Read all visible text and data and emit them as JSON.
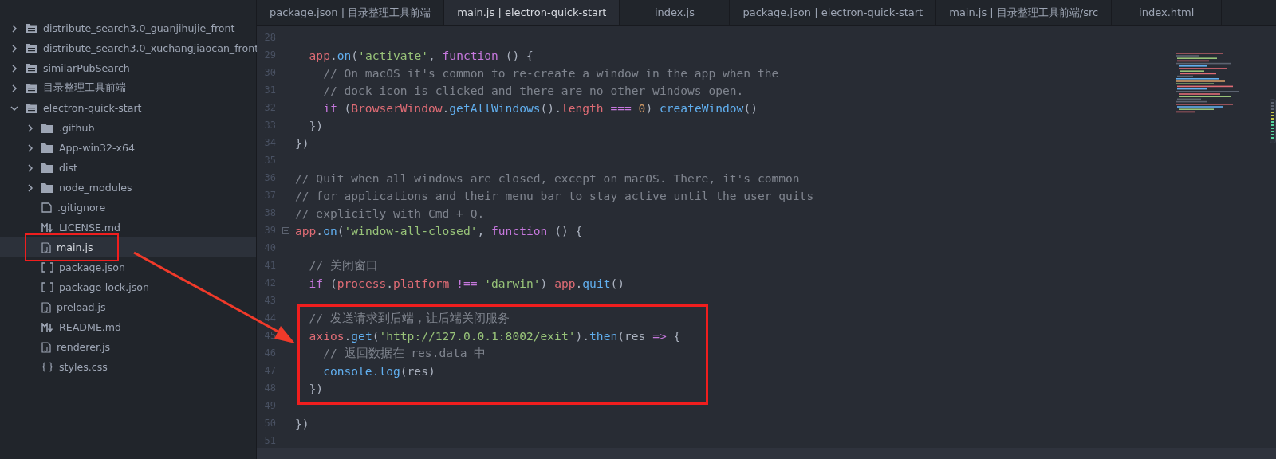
{
  "tree": [
    {
      "name": "distribute_search3.0_guanjihujie_front",
      "kind": "project",
      "expanded": false,
      "selected": false,
      "highlighted": false
    },
    {
      "name": "distribute_search3.0_xuchangjiaocan_front",
      "kind": "project",
      "expanded": false,
      "selected": false,
      "highlighted": false
    },
    {
      "name": "similarPubSearch",
      "kind": "project",
      "expanded": false,
      "selected": false,
      "highlighted": false
    },
    {
      "name": "目录整理工具前端",
      "kind": "project",
      "expanded": false,
      "selected": false,
      "highlighted": false
    },
    {
      "name": "electron-quick-start",
      "kind": "project",
      "expanded": true,
      "selected": false,
      "highlighted": false,
      "children": [
        {
          "name": ".github",
          "kind": "folder",
          "expanded": false,
          "selected": false,
          "highlighted": false
        },
        {
          "name": "App-win32-x64",
          "kind": "folder",
          "expanded": false,
          "selected": false,
          "highlighted": false
        },
        {
          "name": "dist",
          "kind": "folder",
          "expanded": false,
          "selected": false,
          "highlighted": false
        },
        {
          "name": "node_modules",
          "kind": "folder",
          "expanded": false,
          "selected": false,
          "highlighted": false
        },
        {
          "name": ".gitignore",
          "kind": "text",
          "selected": false,
          "highlighted": false
        },
        {
          "name": "LICENSE.md",
          "kind": "markdown",
          "selected": false,
          "highlighted": false
        },
        {
          "name": "main.js",
          "kind": "js",
          "selected": true,
          "highlighted": true
        },
        {
          "name": "package.json",
          "kind": "json",
          "selected": false,
          "highlighted": false
        },
        {
          "name": "package-lock.json",
          "kind": "json",
          "selected": false,
          "highlighted": false
        },
        {
          "name": "preload.js",
          "kind": "js",
          "selected": false,
          "highlighted": false
        },
        {
          "name": "README.md",
          "kind": "markdown",
          "selected": false,
          "highlighted": false
        },
        {
          "name": "renderer.js",
          "kind": "js",
          "selected": false,
          "highlighted": false
        },
        {
          "name": "styles.css",
          "kind": "css",
          "selected": false,
          "highlighted": false
        }
      ]
    }
  ],
  "tabs": [
    {
      "label": "package.json | 目录整理工具前端",
      "selected": false
    },
    {
      "label": "main.js | electron-quick-start",
      "selected": true
    },
    {
      "label": "index.js",
      "selected": false
    },
    {
      "label": "package.json | electron-quick-start",
      "selected": false
    },
    {
      "label": "main.js | 目录整理工具前端/src",
      "selected": false
    },
    {
      "label": "index.html",
      "selected": false
    }
  ],
  "code": [
    {
      "number": "28",
      "highlighted": false,
      "fold": false
    },
    {
      "number": "29",
      "highlighted": false,
      "fold": false,
      "tokens": [
        {
          "kind": "variable",
          "text": "  app"
        },
        {
          "kind": "plain",
          "text": "."
        },
        {
          "kind": "function",
          "text": "on"
        },
        {
          "kind": "plain",
          "text": "("
        },
        {
          "kind": "string",
          "text": "'activate'"
        },
        {
          "kind": "plain",
          "text": ", "
        },
        {
          "kind": "keyword",
          "text": "function"
        },
        {
          "kind": "plain",
          "text": " () {"
        }
      ]
    },
    {
      "number": "30",
      "highlighted": false,
      "fold": false,
      "tokens": [
        {
          "kind": "comment",
          "text": "    // On macOS it's common to re-create a window in the app when the"
        }
      ]
    },
    {
      "number": "31",
      "highlighted": false,
      "fold": false,
      "tokens": [
        {
          "kind": "comment",
          "text": "    // dock icon is clicked and there are no other windows open."
        }
      ]
    },
    {
      "number": "32",
      "highlighted": false,
      "fold": false,
      "tokens": [
        {
          "kind": "keyword",
          "text": "    if"
        },
        {
          "kind": "plain",
          "text": " ("
        },
        {
          "kind": "variable",
          "text": "BrowserWindow"
        },
        {
          "kind": "plain",
          "text": "."
        },
        {
          "kind": "function",
          "text": "getAllWindows"
        },
        {
          "kind": "plain",
          "text": "()."
        },
        {
          "kind": "variable",
          "text": "length"
        },
        {
          "kind": "keyword",
          "text": " === "
        },
        {
          "kind": "number",
          "text": "0"
        },
        {
          "kind": "plain",
          "text": ") "
        },
        {
          "kind": "function",
          "text": "createWindow"
        },
        {
          "kind": "plain",
          "text": "()"
        }
      ]
    },
    {
      "number": "33",
      "highlighted": false,
      "fold": false,
      "tokens": [
        {
          "kind": "plain",
          "text": "  })"
        }
      ]
    },
    {
      "number": "34",
      "highlighted": false,
      "fold": false,
      "tokens": [
        {
          "kind": "plain",
          "text": "})"
        }
      ]
    },
    {
      "number": "35",
      "highlighted": false,
      "fold": false
    },
    {
      "number": "36",
      "highlighted": false,
      "fold": false,
      "tokens": [
        {
          "kind": "comment",
          "text": "// Quit when all windows are closed, except on macOS. There, it's common"
        }
      ]
    },
    {
      "number": "37",
      "highlighted": false,
      "fold": false,
      "tokens": [
        {
          "kind": "comment",
          "text": "// for applications and their menu bar to stay active until the user quits"
        }
      ]
    },
    {
      "number": "38",
      "highlighted": false,
      "fold": false,
      "tokens": [
        {
          "kind": "comment",
          "text": "// explicitly with Cmd + Q."
        }
      ]
    },
    {
      "number": "39",
      "highlighted": false,
      "fold": true,
      "tokens": [
        {
          "kind": "variable",
          "text": "app"
        },
        {
          "kind": "plain",
          "text": "."
        },
        {
          "kind": "function",
          "text": "on"
        },
        {
          "kind": "plain",
          "text": "("
        },
        {
          "kind": "string",
          "text": "'window-all-closed'"
        },
        {
          "kind": "plain",
          "text": ", "
        },
        {
          "kind": "keyword",
          "text": "function"
        },
        {
          "kind": "plain",
          "text": " () {"
        }
      ]
    },
    {
      "number": "40",
      "highlighted": false,
      "fold": false
    },
    {
      "number": "41",
      "highlighted": false,
      "fold": false,
      "tokens": [
        {
          "kind": "comment",
          "text": "  // 关闭窗口"
        }
      ]
    },
    {
      "number": "42",
      "highlighted": false,
      "fold": false,
      "tokens": [
        {
          "kind": "keyword",
          "text": "  if"
        },
        {
          "kind": "plain",
          "text": " ("
        },
        {
          "kind": "variable",
          "text": "process"
        },
        {
          "kind": "plain",
          "text": "."
        },
        {
          "kind": "variable",
          "text": "platform"
        },
        {
          "kind": "keyword",
          "text": " !== "
        },
        {
          "kind": "string",
          "text": "'darwin'"
        },
        {
          "kind": "plain",
          "text": ") "
        },
        {
          "kind": "variable",
          "text": "app"
        },
        {
          "kind": "plain",
          "text": "."
        },
        {
          "kind": "function",
          "text": "quit"
        },
        {
          "kind": "plain",
          "text": "()"
        }
      ]
    },
    {
      "number": "43",
      "highlighted": false,
      "fold": false
    },
    {
      "number": "44",
      "highlighted": true,
      "fold": false,
      "tokens": [
        {
          "kind": "comment",
          "text": "  // 发送请求到后端，让后端关闭服务"
        }
      ]
    },
    {
      "number": "45",
      "highlighted": true,
      "fold": false,
      "tokens": [
        {
          "kind": "variable",
          "text": "  axios"
        },
        {
          "kind": "plain",
          "text": "."
        },
        {
          "kind": "function",
          "text": "get"
        },
        {
          "kind": "plain",
          "text": "("
        },
        {
          "kind": "string",
          "text": "'http://127.0.0.1:8002/exit'"
        },
        {
          "kind": "plain",
          "text": ")."
        },
        {
          "kind": "function",
          "text": "then"
        },
        {
          "kind": "plain",
          "text": "(res "
        },
        {
          "kind": "keyword",
          "text": "=>"
        },
        {
          "kind": "plain",
          "text": " {"
        }
      ]
    },
    {
      "number": "46",
      "highlighted": true,
      "fold": false,
      "tokens": [
        {
          "kind": "comment",
          "text": "    // 返回数据在 res.data 中"
        }
      ]
    },
    {
      "number": "47",
      "highlighted": true,
      "fold": false,
      "tokens": [
        {
          "kind": "function",
          "text": "    console.log"
        },
        {
          "kind": "plain",
          "text": "(res)"
        }
      ]
    },
    {
      "number": "48",
      "highlighted": true,
      "fold": false,
      "tokens": [
        {
          "kind": "plain",
          "text": "  })"
        }
      ]
    },
    {
      "number": "49",
      "highlighted": false,
      "fold": false
    },
    {
      "number": "50",
      "highlighted": false,
      "fold": false,
      "tokens": [
        {
          "kind": "plain",
          "text": "})"
        }
      ]
    },
    {
      "number": "51",
      "highlighted": false,
      "fold": false
    }
  ]
}
